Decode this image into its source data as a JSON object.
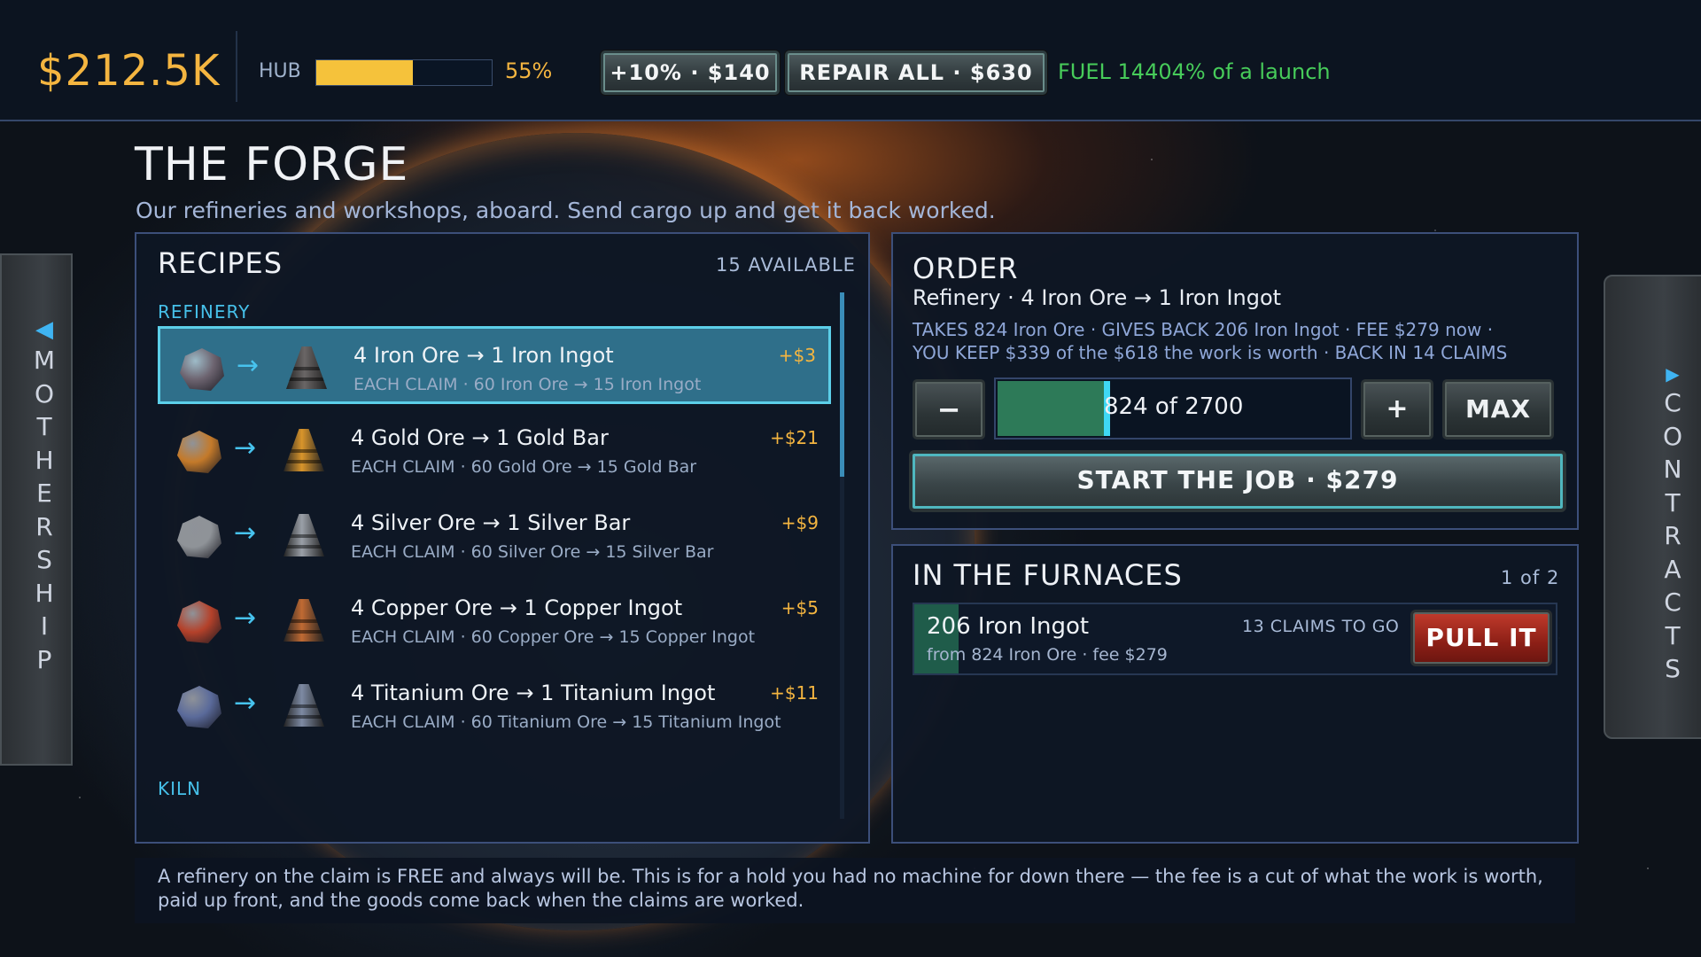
{
  "header": {
    "money": "$212.5K",
    "hub_label": "HUB",
    "hub_progress": 0.55,
    "hub_percent": "55%",
    "upgrade_button": "+10% · $140",
    "repair_button": "REPAIR ALL · $630",
    "fuel": "FUEL 14404% of a launch"
  },
  "page": {
    "title": "THE FORGE",
    "subtitle": "Our refineries and workshops, aboard. Send cargo up and get it back worked."
  },
  "side_left": {
    "arrow": "◀",
    "letters": [
      "M",
      "O",
      "T",
      "H",
      "E",
      "R",
      "S",
      "H",
      "I",
      "P"
    ]
  },
  "side_right": {
    "arrow": "▶",
    "letters": [
      "C",
      "O",
      "N",
      "T",
      "R",
      "A",
      "C",
      "T",
      "S"
    ]
  },
  "recipes": {
    "heading": "RECIPES",
    "count": "15 AVAILABLE",
    "section_refinery": "REFINERY",
    "section_kiln": "KILN",
    "arrow_glyph": "→",
    "items": [
      {
        "title": "4 Iron Ore → 1 Iron Ingot",
        "sub": "EACH CLAIM · 60 Iron Ore → 15 Iron Ingot",
        "profit": "+$3",
        "ore_color": "#6d6470",
        "ingot_color": "#6a6666"
      },
      {
        "title": "4 Gold Ore → 1 Gold Bar",
        "sub": "EACH CLAIM · 60 Gold Ore → 15 Gold Bar",
        "profit": "+$21",
        "ore_color": "#c47a2a",
        "ingot_color": "#d9952b"
      },
      {
        "title": "4 Silver Ore → 1 Silver Bar",
        "sub": "EACH CLAIM · 60 Silver Ore → 15 Silver Bar",
        "profit": "+$9",
        "ore_color": "#8f9398",
        "ingot_color": "#9aa0a8"
      },
      {
        "title": "4 Copper Ore → 1 Copper Ingot",
        "sub": "EACH CLAIM · 60 Copper Ore → 15 Copper Ingot",
        "profit": "+$5",
        "ore_color": "#b4412a",
        "ingot_color": "#c06a33"
      },
      {
        "title": "4 Titanium Ore → 1 Titanium Ingot",
        "sub": "EACH CLAIM · 60 Titanium Ore → 15 Titanium Ingot",
        "profit": "+$11",
        "ore_color": "#5a6a9a",
        "ingot_color": "#7d8aa3"
      }
    ]
  },
  "order": {
    "heading": "ORDER",
    "recipe": "Refinery · 4 Iron Ore → 1 Iron Ingot",
    "line1": "TAKES 824 Iron Ore · GIVES BACK 206 Iron Ingot · FEE $279 now ·",
    "line2": "YOU KEEP $339 of the $618 the work is worth · BACK IN 14 CLAIMS",
    "minus": "−",
    "plus": "+",
    "max": "MAX",
    "quantity_text": "824 of 2700",
    "quantity_fraction": 0.305,
    "start_button": "START THE JOB · $279"
  },
  "furnaces": {
    "heading": "IN THE FURNACES",
    "count": "1 of 2",
    "job": {
      "title": "206 Iron Ingot",
      "sub": "from 824 Iron Ore · fee $279",
      "claims": "13 CLAIMS TO GO",
      "pull": "PULL IT"
    }
  },
  "footer": "A refinery on the claim is FREE and always will be. This is for a hold you had no machine for down there — the fee is a cut of what the work is worth, paid up front, and the goods come back when the claims are worked."
}
